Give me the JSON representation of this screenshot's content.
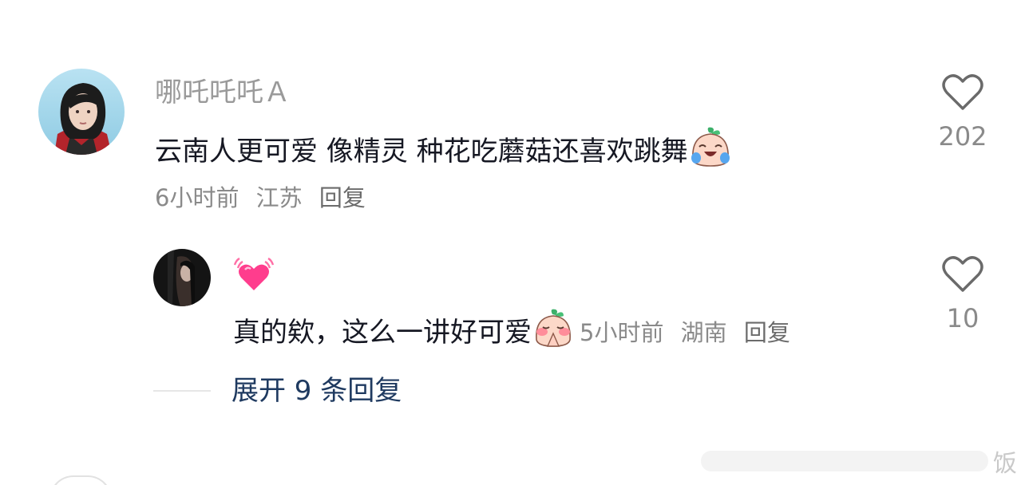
{
  "comment": {
    "username": "哪吒吒吒Ａ",
    "text": "云南人更可爱 像精灵 种花吃蘑菇还喜欢跳舞",
    "time": "6小时前",
    "location": "江苏",
    "reply_label": "回复",
    "like_count": "202",
    "emoji_icon": "crying-laughing-sticker-icon"
  },
  "reply": {
    "username_emoji": "💓",
    "text": "真的欸，这么一讲好可爱",
    "time": "5小时前",
    "location": "湖南",
    "reply_label": "回复",
    "like_count": "10",
    "emoji_icon": "shy-praying-sticker-icon"
  },
  "expand": {
    "label": "展开 9 条回复"
  },
  "watermark": {
    "text": "饭"
  },
  "colors": {
    "primary_text": "#161823",
    "secondary_text": "#8a8a8a",
    "link_blue": "#1f3a60"
  }
}
